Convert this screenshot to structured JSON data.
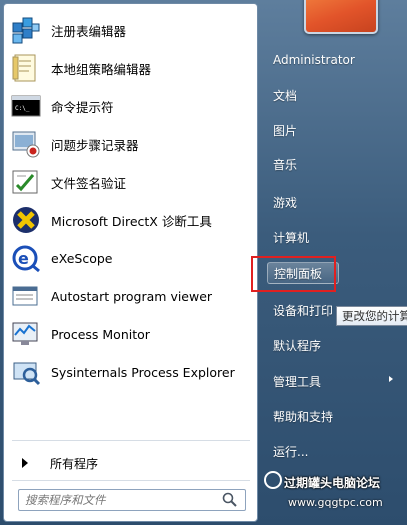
{
  "programs": [
    {
      "label": "注册表编辑器",
      "icon": "registry-editor-icon"
    },
    {
      "label": "本地组策略编辑器",
      "icon": "group-policy-editor-icon"
    },
    {
      "label": "命令提示符",
      "icon": "command-prompt-icon"
    },
    {
      "label": "问题步骤记录器",
      "icon": "steps-recorder-icon"
    },
    {
      "label": "文件签名验证",
      "icon": "file-signature-icon"
    },
    {
      "label": "Microsoft DirectX 诊断工具",
      "icon": "directx-icon"
    },
    {
      "label": "eXeScope",
      "icon": "exescope-icon"
    },
    {
      "label": "Autostart program viewer",
      "icon": "autostart-viewer-icon"
    },
    {
      "label": "Process Monitor",
      "icon": "process-monitor-icon"
    },
    {
      "label": "Sysinternals Process Explorer",
      "icon": "process-explorer-icon"
    }
  ],
  "all_programs": "所有程序",
  "search_placeholder": "搜索程序和文件",
  "right_menu": [
    {
      "label": "Administrator"
    },
    {
      "label": "文档"
    },
    {
      "label": "图片"
    },
    {
      "label": "音乐"
    },
    {
      "label": "游戏"
    },
    {
      "label": "计算机"
    },
    {
      "label": "控制面板"
    },
    {
      "label": "设备和打印"
    },
    {
      "label": "默认程序"
    },
    {
      "label": "管理工具"
    },
    {
      "label": "帮助和支持"
    },
    {
      "label": "运行..."
    }
  ],
  "tooltip": "更改您的计算",
  "watermark": {
    "title": "过期罐头电脑论坛",
    "url": "www.gqgtpc.com"
  },
  "colors": {
    "highlight_box": "#e02020",
    "menu_bg": "#3b5c7c"
  }
}
